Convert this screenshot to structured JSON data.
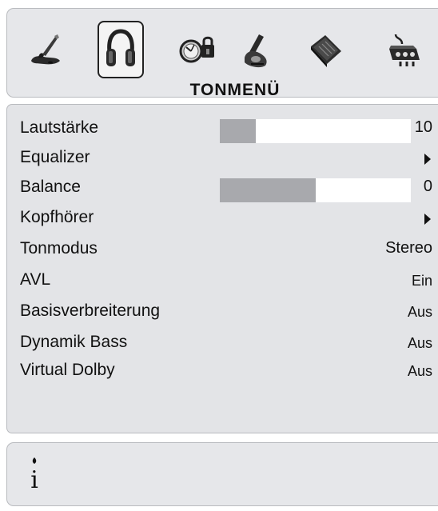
{
  "header": {
    "title": "TONMENÜ",
    "icons": [
      {
        "name": "picture-brush-icon",
        "selected": false
      },
      {
        "name": "headphones-sound-icon",
        "selected": true
      },
      {
        "name": "clock-lock-icon",
        "selected": false
      },
      {
        "name": "setup-wrench-icon",
        "selected": false
      },
      {
        "name": "book-icon",
        "selected": false
      },
      {
        "name": "connector-sources-icon",
        "selected": false
      }
    ]
  },
  "menu": {
    "items": [
      {
        "label": "Lautstärke",
        "value": "10",
        "bar_level": 0.19
      },
      {
        "label": "Equalizer",
        "value": "",
        "submenu": true
      },
      {
        "label": "Balance",
        "value": "0",
        "bar_level": 0.5
      },
      {
        "label": "Kopfhörer",
        "value": "",
        "submenu": true
      },
      {
        "label": "Tonmodus",
        "value": "Stereo"
      },
      {
        "label": "AVL",
        "value": "Ein"
      },
      {
        "label": "Basisverbreiterung",
        "value": "Aus"
      },
      {
        "label": "Dynamik Bass",
        "value": "Aus"
      },
      {
        "label": "Virtual Dolby",
        "value": "Aus"
      }
    ]
  },
  "info": {
    "icon": "info-icon",
    "glyph": "i"
  },
  "colors": {
    "panel": "#e3e4e7",
    "bar_fill": "#a8a9ad",
    "bar_track": "#ffffff",
    "text": "#111111"
  }
}
